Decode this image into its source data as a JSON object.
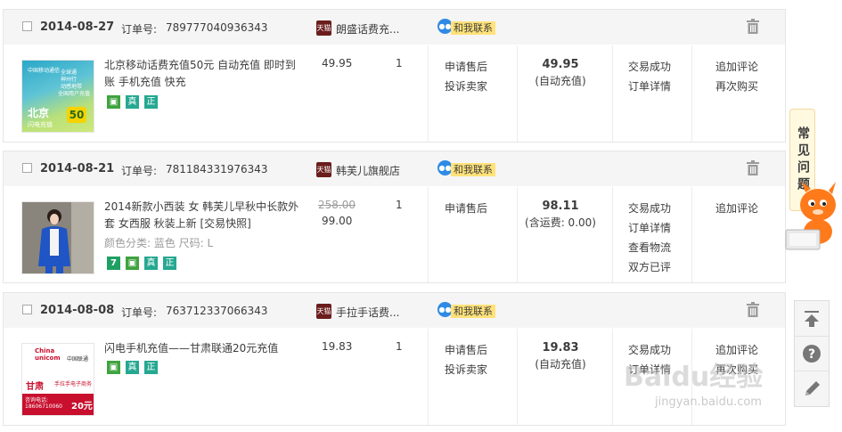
{
  "labels": {
    "order_no": "订单号:"
  },
  "colors": {
    "contact_badge": "#ffe27a",
    "chat_bubble": "#2f8ae5",
    "green_badge": "#3fa33f",
    "teal_badge": "#25a891"
  },
  "orders": [
    {
      "date": "2014-08-27",
      "order_no": "789777040936343",
      "shop": "朗盛话费充...",
      "shop_icon": "tmall-icon",
      "contact": "和我联系",
      "thumb": {
        "brand": "中国移动通信",
        "region": "北京",
        "amount": "50",
        "lines": [
          "全球通",
          "神州行",
          "动感地带",
          "全国用户充值"
        ],
        "caption": "闪电充值"
      },
      "title": "北京移动话费充值50元 自动充值 即时到账 手机充值 快充",
      "price": "49.95",
      "qty": "1",
      "ops": [
        "申请售后",
        "投诉卖家"
      ],
      "total": "49.95",
      "total_note": "(自动充值)",
      "status": [
        "交易成功",
        "订单详情"
      ],
      "actions": [
        "追加评论",
        "再次购买"
      ],
      "badges": [
        "mobile-icon",
        "真",
        "正"
      ]
    },
    {
      "date": "2014-08-21",
      "order_no": "781184331976343",
      "shop": "韩芙儿旗舰店",
      "shop_icon": "tmall-icon",
      "contact": "和我联系",
      "title": "2014新款小西装 女 韩芙儿早秋中长款外套 女西服 秋装上新 [交易快照]",
      "attr": "颜色分类: 蓝色  尺码: L",
      "price_old": "258.00",
      "price": "99.00",
      "qty": "1",
      "ops": [
        "申请售后"
      ],
      "total": "98.11",
      "total_note": "(含运费: 0.00)",
      "status": [
        "交易成功",
        "订单详情",
        "查看物流",
        "双方已评"
      ],
      "actions": [
        "追加评论"
      ],
      "badges": [
        "7",
        "mobile-icon",
        "真",
        "正"
      ]
    },
    {
      "date": "2014-08-08",
      "order_no": "763712337066343",
      "shop": "手拉手话费...",
      "shop_icon": "tmall-icon",
      "contact": "和我联系",
      "thumb": {
        "brand_en": "China unicom",
        "brand": "中国联通",
        "region": "甘肃",
        "amount": "20元",
        "phone_label": "咨询电话:",
        "phone": "18606710060",
        "shop": "手拉手电子商务"
      },
      "title": "闪电手机充值——甘肃联通20元充值",
      "price": "19.83",
      "qty": "1",
      "ops": [
        "申请售后",
        "投诉卖家"
      ],
      "total": "19.83",
      "total_note": "(自动充值)",
      "status": [
        "交易成功",
        "订单详情"
      ],
      "actions": [
        "追加评论",
        "再次购买"
      ],
      "badges": [
        "mobile-icon",
        "真",
        "正"
      ]
    }
  ],
  "faq": "常见问题",
  "watermark": {
    "main": "Baidu经验",
    "sub": "jingyan.baidu.com"
  }
}
